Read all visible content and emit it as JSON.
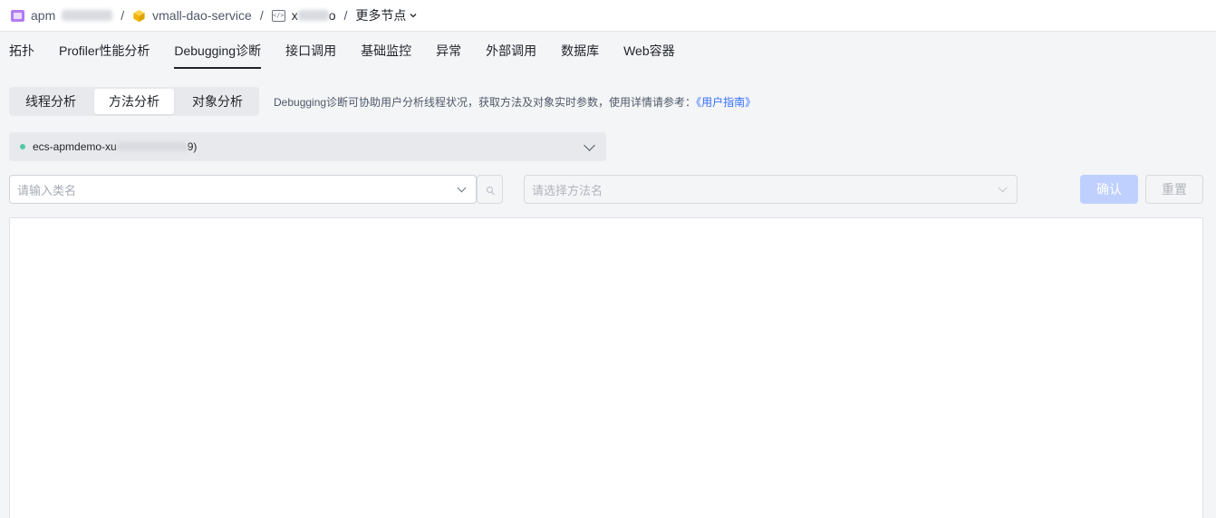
{
  "breadcrumb": {
    "app": "apm",
    "service": "vmall-dao-service",
    "node_prefix": "x",
    "node_suffix": "o",
    "more": "更多节点"
  },
  "tabs": [
    "拓扑",
    "Profiler性能分析",
    "Debugging诊断",
    "接口调用",
    "基础监控",
    "异常",
    "外部调用",
    "数据库",
    "Web容器"
  ],
  "active_tab": "Debugging诊断",
  "segment": {
    "items": [
      "线程分析",
      "方法分析",
      "对象分析"
    ],
    "active": "方法分析"
  },
  "hint": {
    "text": "Debugging诊断可协助用户分析线程状况，获取方法及对象实时参数，使用详情请参考：",
    "link": "《用户指南》"
  },
  "instance": {
    "prefix": "ecs-apmdemo-xu",
    "suffix": "9)",
    "status_color": "#52c9a0"
  },
  "class_input": {
    "placeholder": "请输入类名"
  },
  "method_select": {
    "placeholder": "请选择方法名"
  },
  "buttons": {
    "confirm": "确认",
    "reset": "重置"
  },
  "colors": {
    "primary_disabled": "#bfd0ff",
    "link": "#3370ff"
  }
}
